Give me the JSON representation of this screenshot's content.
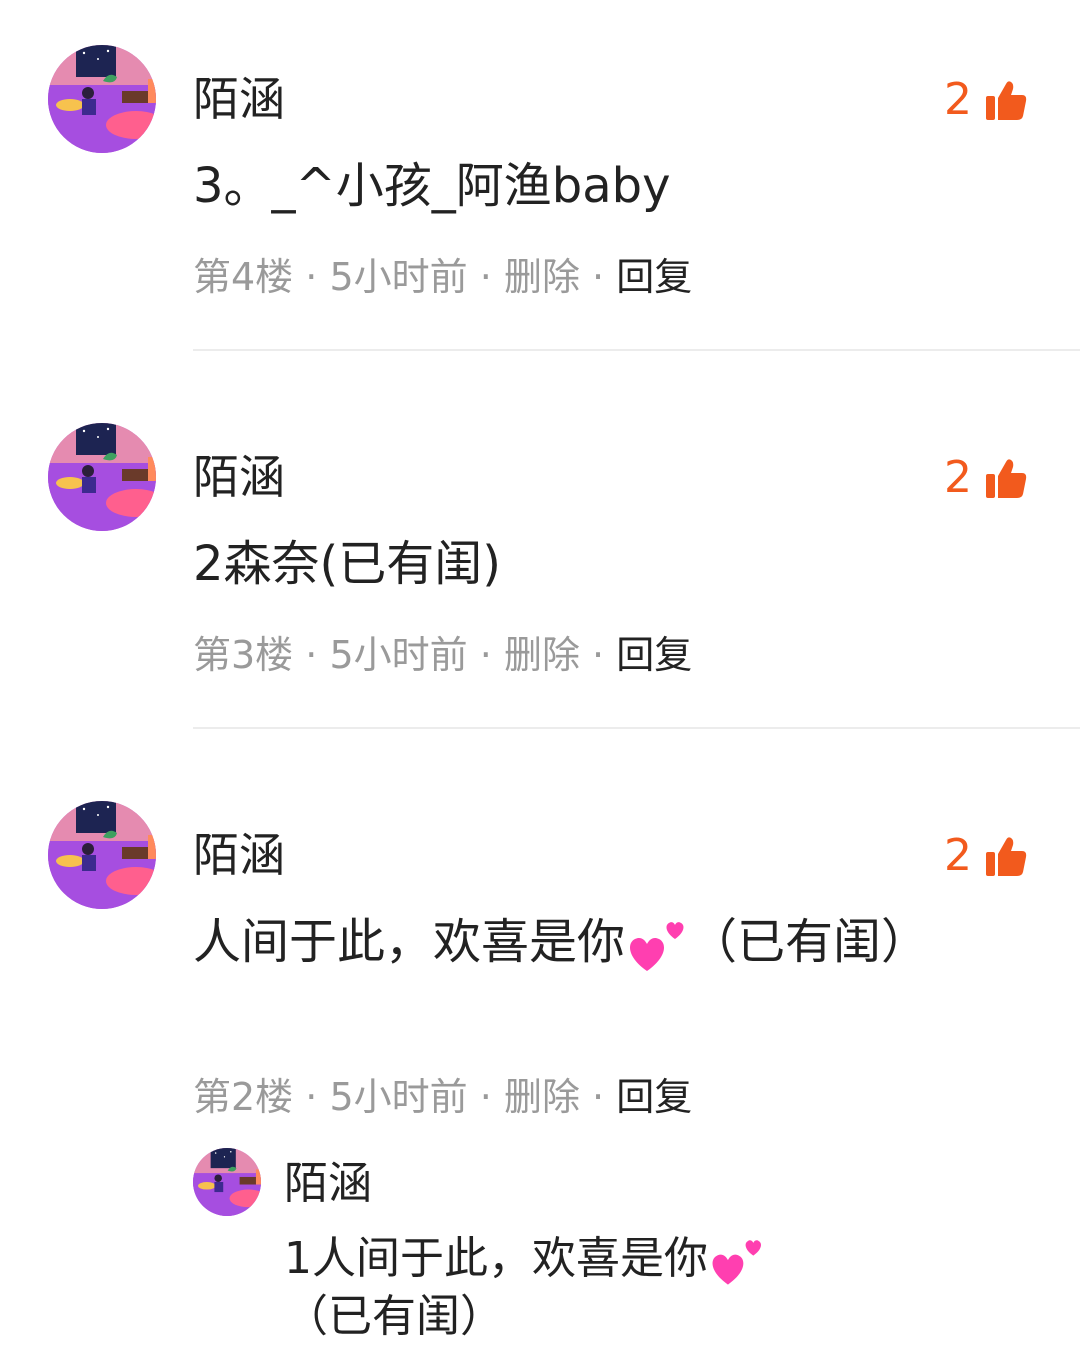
{
  "comments": [
    {
      "name": "陌涵",
      "likes": "2",
      "content": "3。_^小孩_阿渔baby",
      "floor": "第4楼",
      "time": "5小时前",
      "delete": "删除",
      "reply": "回复"
    },
    {
      "name": "陌涵",
      "likes": "2",
      "content": "2森奈(已有闺)",
      "floor": "第3楼",
      "time": "5小时前",
      "delete": "删除",
      "reply": "回复"
    },
    {
      "name": "陌涵",
      "likes": "2",
      "content_before": "人间于此，欢喜是你",
      "content_after": "（已有闺）",
      "floor": "第2楼",
      "time": "5小时前",
      "delete": "删除",
      "reply": "回复"
    }
  ],
  "subreply": {
    "name": "陌涵",
    "content_before": "1人间于此，欢喜是你",
    "content_after": "（已有闺）"
  },
  "separator": "·",
  "colors": {
    "accent": "#f25a1d",
    "meta": "#9a9a9a",
    "heart": "#ff3fb0"
  },
  "icons": {
    "like": "thumbs-up-icon",
    "heart": "two-hearts-emoji"
  }
}
